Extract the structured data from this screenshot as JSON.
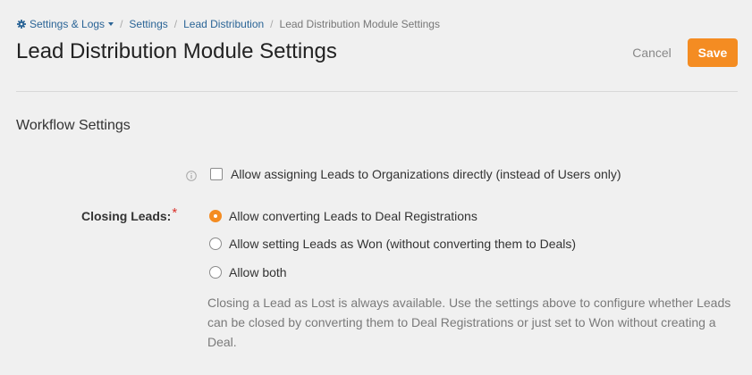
{
  "breadcrumb": {
    "menu_label": "Settings & Logs",
    "items": [
      "Settings",
      "Lead Distribution"
    ],
    "current": "Lead Distribution Module Settings"
  },
  "header": {
    "title": "Lead Distribution Module Settings",
    "cancel_label": "Cancel",
    "save_label": "Save"
  },
  "section": {
    "title": "Workflow Settings"
  },
  "org_assign": {
    "label": "Allow assigning Leads to Organizations directly (instead of Users only)",
    "checked": false
  },
  "closing_leads": {
    "label": "Closing Leads:",
    "required_mark": "*",
    "options": [
      {
        "label": "Allow converting Leads to Deal Registrations",
        "selected": true
      },
      {
        "label": "Allow setting Leads as Won (without converting them to Deals)",
        "selected": false
      },
      {
        "label": "Allow both",
        "selected": false
      }
    ],
    "help": "Closing a Lead as Lost is always available. Use the settings above to configure whether Leads can be closed by converting them to Deal Registrations or just set to Won without creating a Deal."
  },
  "colors": {
    "accent": "#f48c22",
    "link": "#2a6496",
    "required": "#d9322c"
  },
  "icons": {
    "settings_menu": "gear-icon",
    "info": "info-icon"
  }
}
